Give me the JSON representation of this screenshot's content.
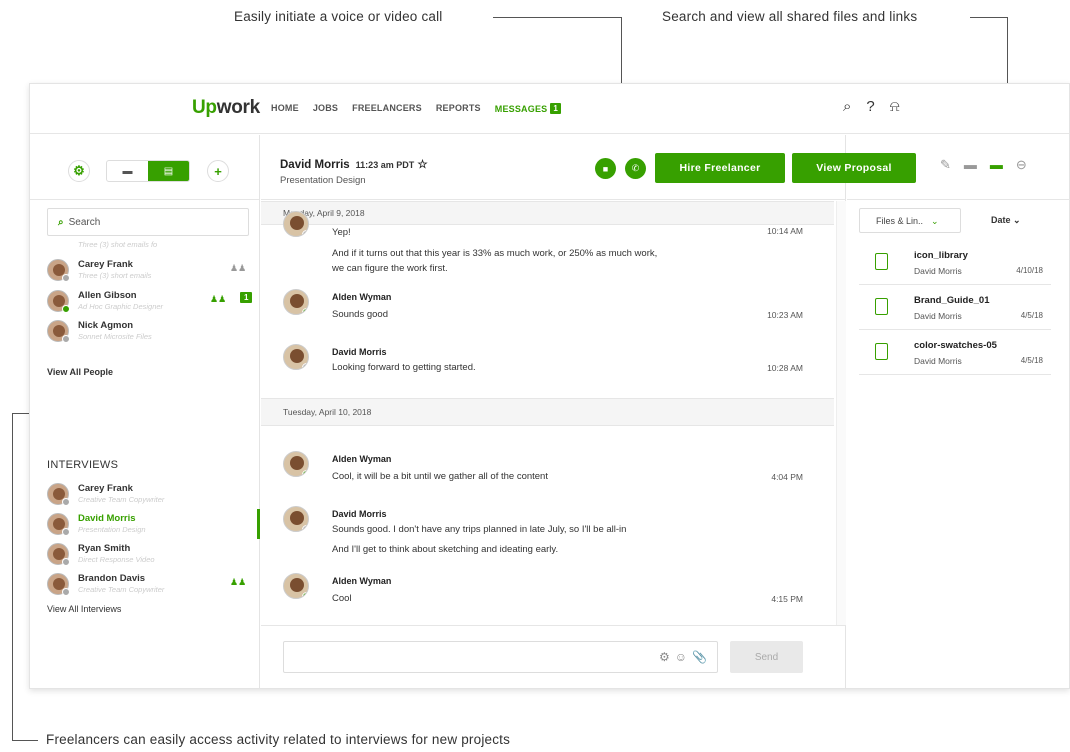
{
  "callouts": {
    "call": "Easily initiate a voice or video call",
    "files": "Search and view all shared files and links",
    "interviews": "Freelancers can easily access activity related to interviews for new projects"
  },
  "nav": {
    "logo_up": "Up",
    "logo_work": "work",
    "items": [
      "HOME",
      "JOBS",
      "FREELANCERS",
      "REPORTS"
    ],
    "active": "MESSAGES",
    "active_badge": "1",
    "icons": [
      "search-icon",
      "help-icon",
      "bell-icon"
    ]
  },
  "left": {
    "search_placeholder": "Search",
    "people": [
      {
        "name": "",
        "sub": "Three (3) shot emails fo"
      },
      {
        "name": "Carey Frank",
        "sub": "Three (3) short emails"
      },
      {
        "name": "Allen Gibson",
        "sub": "Ad Hoc Graphic Designer",
        "badge": "1"
      },
      {
        "name": "Nick Agmon",
        "sub": "Sonnet Microsite Files"
      }
    ],
    "view_all_people": "View All People",
    "section": "INTERVIEWS",
    "interviews": [
      {
        "name": "Carey Frank",
        "sub": "Creative Team Copywriter"
      },
      {
        "name": "David Morris",
        "sub": "Presentation Design"
      },
      {
        "name": "Ryan Smith",
        "sub": "Direct Response Video"
      },
      {
        "name": "Brandon Davis",
        "sub": "Creative Team Copywriter"
      }
    ],
    "view_all_interviews": "View All Interviews"
  },
  "chat": {
    "name": "David Morris",
    "time": "11:23 am PDT",
    "star": "☆",
    "subtitle": "Presentation Design",
    "hire": "Hire Freelancer",
    "proposal": "View Proposal",
    "day1": "Monday, April 9, 2018",
    "day2": "Tuesday, April 10, 2018",
    "m0": {
      "text": "Yep!",
      "time": "10:14 AM"
    },
    "m1": {
      "line1": "And if it turns out that this year is 33% as much work, or 250% as much work,",
      "line2": "we can figure the work first."
    },
    "m2": {
      "name": "Alden Wyman",
      "text": "Sounds good",
      "time": "10:23 AM"
    },
    "m3": {
      "name": "David Morris",
      "text": "Looking forward to getting started.",
      "time": "10:28 AM"
    },
    "m4": {
      "name": "Alden Wyman",
      "text": "Cool, it will be a bit until we gather all of the content",
      "time": "4:04 PM"
    },
    "m5": {
      "name": "David Morris",
      "line1": "Sounds good. I don't have any trips planned in late July, so I'll be all-in",
      "line2": "And I'll get to think about sketching and ideating early."
    },
    "m6": {
      "name": "Alden Wyman",
      "text": "Cool",
      "time": "4:15 PM"
    },
    "send": "Send"
  },
  "right": {
    "filter": "Files & Lin..",
    "sort": "Date",
    "files": [
      {
        "name": "icon_library",
        "author": "David Morris",
        "date": "4/10/18"
      },
      {
        "name": "Brand_Guide_01",
        "author": "David Morris",
        "date": "4/5/18"
      },
      {
        "name": "color-swatches-05",
        "author": "David Morris",
        "date": "4/5/18"
      }
    ]
  },
  "colors": {
    "accent": "#37a000"
  }
}
